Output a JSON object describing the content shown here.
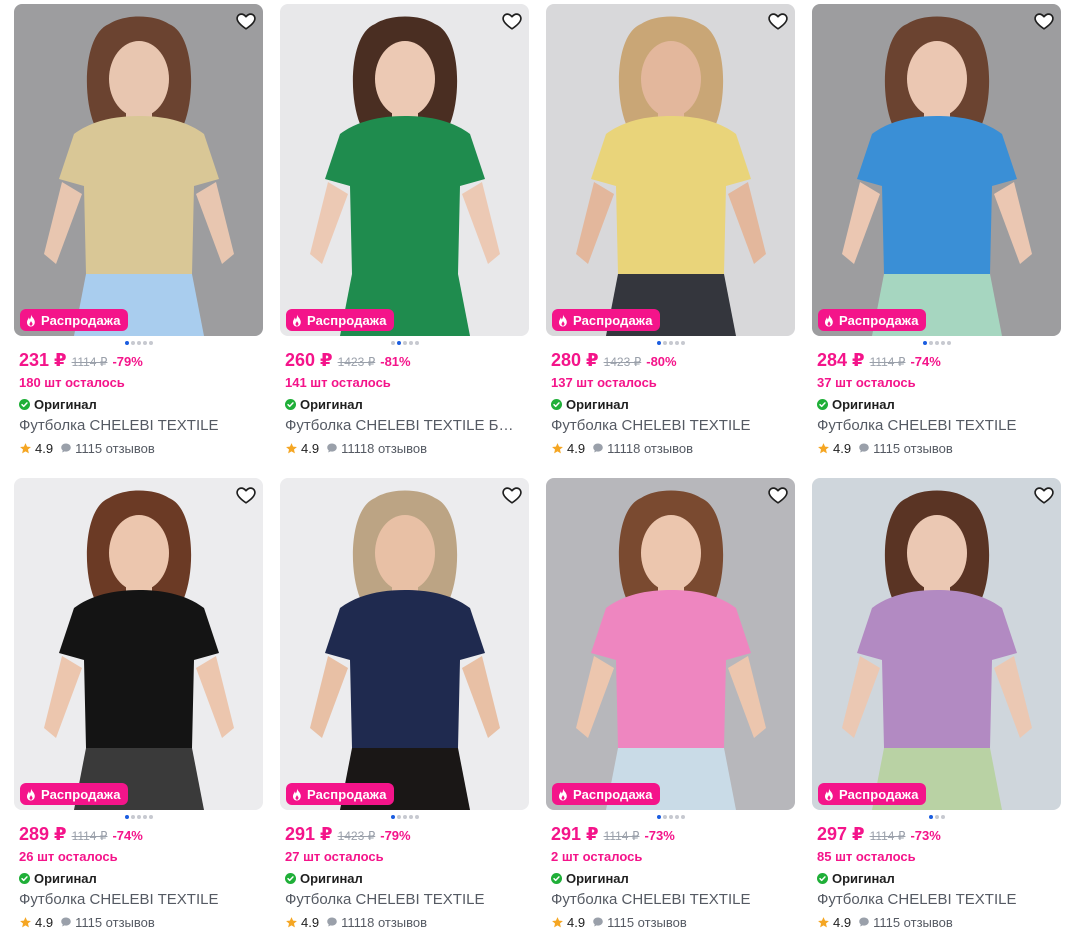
{
  "colors": {
    "accent": "#f4148a",
    "star": "#f5a623",
    "check": "#1faf38",
    "dot_active": "#1b5de0"
  },
  "icons": {
    "favorite": "heart-outline-icon",
    "badge": "flame-icon",
    "original": "check-circle-icon",
    "rating": "star-icon",
    "reviews": "chat-bubble-icon"
  },
  "products": [
    {
      "badge": "Распродажа",
      "price": "231 ₽",
      "old_price": "1114 ₽",
      "discount": "-79%",
      "stock": "180 шт осталось",
      "original": "Оригинал",
      "title": "Футболка CHELEBI TEXTILE",
      "rating": "4.9",
      "reviews": "1115 отзывов",
      "shirt": "#d9c796",
      "bg": "#9d9d9f",
      "skin": "#e8c6b0",
      "hair": "#6b4330",
      "bottom": "#a9cdee",
      "active_dot": 0,
      "dot_count": 5
    },
    {
      "badge": "Распродажа",
      "price": "260 ₽",
      "old_price": "1423 ₽",
      "discount": "-81%",
      "stock": "141 шт осталось",
      "original": "Оригинал",
      "title": "Футболка CHELEBI TEXTILE Баз...",
      "rating": "4.9",
      "reviews": "11118 отзывов",
      "shirt": "#1f8c4e",
      "bg": "#e8e8ea",
      "skin": "#ecc9b4",
      "hair": "#4a2e22",
      "bottom": "#1f8c4e",
      "active_dot": 1,
      "dot_count": 5
    },
    {
      "badge": "Распродажа",
      "price": "280 ₽",
      "old_price": "1423 ₽",
      "discount": "-80%",
      "stock": "137 шт осталось",
      "original": "Оригинал",
      "title": "Футболка CHELEBI TEXTILE",
      "rating": "4.9",
      "reviews": "11118 отзывов",
      "shirt": "#e9d47a",
      "bg": "#d8d8da",
      "skin": "#e3b79c",
      "hair": "#c9a676",
      "bottom": "#34363d",
      "active_dot": 0,
      "dot_count": 5
    },
    {
      "badge": "Распродажа",
      "price": "284 ₽",
      "old_price": "1114 ₽",
      "discount": "-74%",
      "stock": "37 шт осталось",
      "original": "Оригинал",
      "title": "Футболка CHELEBI TEXTILE",
      "rating": "4.9",
      "reviews": "1115 отзывов",
      "shirt": "#3a8fd6",
      "bg": "#9d9d9f",
      "skin": "#ebc7b2",
      "hair": "#6b4330",
      "bottom": "#a6d6c0",
      "active_dot": 0,
      "dot_count": 5
    },
    {
      "badge": "Распродажа",
      "price": "289 ₽",
      "old_price": "1114 ₽",
      "discount": "-74%",
      "stock": "26 шт осталось",
      "original": "Оригинал",
      "title": "Футболка CHELEBI TEXTILE",
      "rating": "4.9",
      "reviews": "1115 отзывов",
      "shirt": "#141414",
      "bg": "#ececee",
      "skin": "#ecc6ae",
      "hair": "#6b3a25",
      "bottom": "#3a3a3a",
      "active_dot": 0,
      "dot_count": 5
    },
    {
      "badge": "Распродажа",
      "price": "291 ₽",
      "old_price": "1423 ₽",
      "discount": "-79%",
      "stock": "27 шт осталось",
      "original": "Оригинал",
      "title": "Футболка CHELEBI TEXTILE",
      "rating": "4.9",
      "reviews": "11118 отзывов",
      "shirt": "#1f2a4f",
      "bg": "#ececee",
      "skin": "#e8c0a5",
      "hair": "#bca484",
      "bottom": "#1a1716",
      "active_dot": 0,
      "dot_count": 5
    },
    {
      "badge": "Распродажа",
      "price": "291 ₽",
      "old_price": "1114 ₽",
      "discount": "-73%",
      "stock": "2 шт осталось",
      "original": "Оригинал",
      "title": "Футболка CHELEBI TEXTILE",
      "rating": "4.9",
      "reviews": "1115 отзывов",
      "shirt": "#ee86c0",
      "bg": "#b7b7bb",
      "skin": "#ecc6ae",
      "hair": "#7a4a30",
      "bottom": "#c9dbe7",
      "active_dot": 0,
      "dot_count": 5
    },
    {
      "badge": "Распродажа",
      "price": "297 ₽",
      "old_price": "1114 ₽",
      "discount": "-73%",
      "stock": "85 шт осталось",
      "original": "Оригинал",
      "title": "Футболка CHELEBI TEXTILE",
      "rating": "4.9",
      "reviews": "1115 отзывов",
      "shirt": "#b28ac2",
      "bg": "#cfd6dc",
      "skin": "#ebc8b3",
      "hair": "#5a3424",
      "bottom": "#b9d2a4",
      "active_dot": 0,
      "dot_count": 3
    }
  ]
}
